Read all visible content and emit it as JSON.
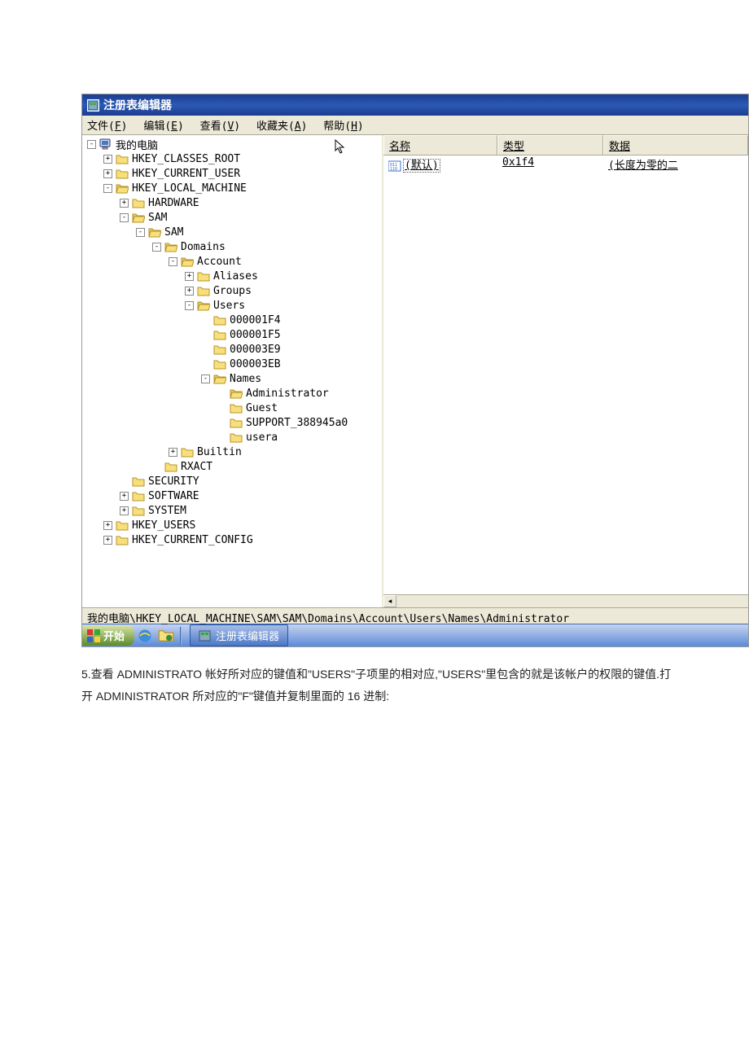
{
  "window": {
    "title": "注册表编辑器"
  },
  "menu": {
    "file": "文件(F)",
    "edit": "编辑(E)",
    "view": "查看(V)",
    "fav": "收藏夹(A)",
    "help": "帮助(H)"
  },
  "tree": {
    "root": "我的电脑",
    "hkcr": "HKEY_CLASSES_ROOT",
    "hkcu": "HKEY_CURRENT_USER",
    "hklm": "HKEY_LOCAL_MACHINE",
    "hardware": "HARDWARE",
    "sam1": "SAM",
    "sam2": "SAM",
    "domains": "Domains",
    "account": "Account",
    "aliases": "Aliases",
    "groups": "Groups",
    "users": "Users",
    "u1": "000001F4",
    "u2": "000001F5",
    "u3": "000003E9",
    "u4": "000003EB",
    "names": "Names",
    "admin": "Administrator",
    "guest": "Guest",
    "support": "SUPPORT_388945a0",
    "usera": "usera",
    "builtin": "Builtin",
    "rxact": "RXACT",
    "security": "SECURITY",
    "software": "SOFTWARE",
    "system": "SYSTEM",
    "hku": "HKEY_USERS",
    "hkcc": "HKEY_CURRENT_CONFIG"
  },
  "list": {
    "headers": {
      "name": "名称",
      "type": "类型",
      "data": "数据"
    },
    "row0": {
      "name": "(默认)",
      "type": "0x1f4",
      "data": "(长度为零的二"
    }
  },
  "statusbar": "我的电脑\\HKEY_LOCAL_MACHINE\\SAM\\SAM\\Domains\\Account\\Users\\Names\\Administrator",
  "taskbar": {
    "start": "开始",
    "task1": "注册表编辑器"
  },
  "caption": {
    "line1": "5.查看 ADMINISTRATO 帐好所对应的键值和\"USERS\"子项里的相对应,\"USERS\"里包含的就是该帐户的权限的键值.打",
    "line2": "开 ADMINISTRATOR 所对应的\"F\"键值并复制里面的 16 进制:"
  }
}
